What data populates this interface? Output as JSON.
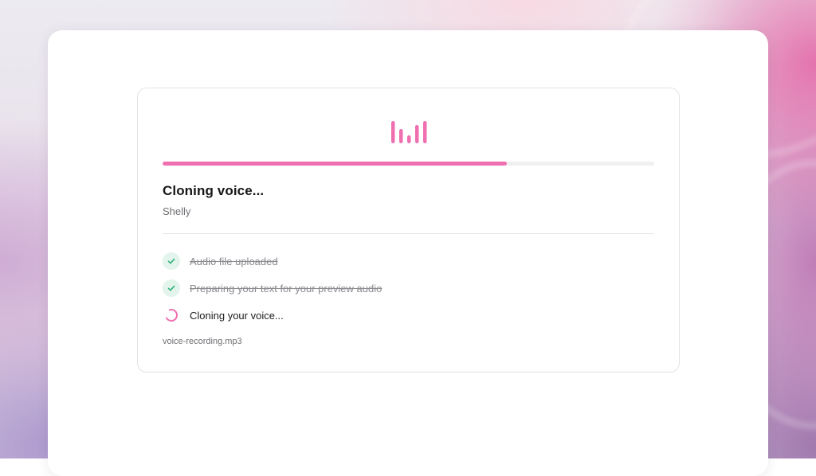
{
  "theme": {
    "accent": "#ef6fb0",
    "track": "#f0f0f2",
    "done_icon": "#2fb37a"
  },
  "logo": {
    "icon": "audio-bars-icon"
  },
  "progress": {
    "fraction": 0.7
  },
  "status": {
    "title": "Cloning voice...",
    "voice_name": "Shelly"
  },
  "steps": [
    {
      "label": "Audio file uploaded",
      "state": "done",
      "icon": "check-icon"
    },
    {
      "label": "Preparing your text for your preview audio",
      "state": "done",
      "icon": "check-icon"
    },
    {
      "label": "Cloning your voice...",
      "state": "active",
      "icon": "spinner-icon"
    }
  ],
  "file": {
    "name": "voice-recording.mp3"
  }
}
